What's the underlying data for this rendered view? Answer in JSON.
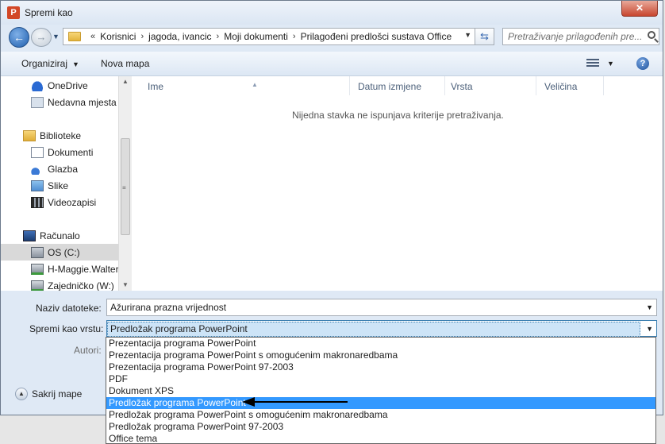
{
  "window": {
    "title": "Spremi kao",
    "close_label": "✕"
  },
  "address_bar": {
    "crumbs": [
      "Korisnici",
      "jagoda, ivancic",
      "Moji dokumenti",
      "Prilagođeni predlošci sustava Office"
    ],
    "overflow_label": "«",
    "separator": "›"
  },
  "search": {
    "placeholder": "Pretraživanje prilagođenih pre..."
  },
  "toolbar": {
    "organize_label": "Organiziraj",
    "new_folder_label": "Nova mapa"
  },
  "nav_pane": {
    "items": [
      {
        "label": "OneDrive",
        "icon": "onedrive-icon"
      },
      {
        "label": "Nedavna mjesta",
        "icon": "recent-places-icon"
      },
      {
        "label": "Biblioteke",
        "icon": "libraries-icon"
      },
      {
        "label": "Dokumenti",
        "icon": "documents-icon"
      },
      {
        "label": "Glazba",
        "icon": "music-icon"
      },
      {
        "label": "Slike",
        "icon": "pictures-icon"
      },
      {
        "label": "Videozapisi",
        "icon": "videos-icon"
      },
      {
        "label": "Računalo",
        "icon": "computer-icon"
      },
      {
        "label": "OS (C:)",
        "icon": "drive-icon"
      },
      {
        "label": "H-Maggie.Walter",
        "icon": "network-drive-icon"
      },
      {
        "label": "Zajedničko (W:)",
        "icon": "network-drive-icon"
      }
    ]
  },
  "file_list": {
    "columns": [
      "Ime",
      "Datum izmjene",
      "Vrsta",
      "Veličina"
    ],
    "empty_message": "Nijedna stavka ne ispunjava kriterije pretraživanja."
  },
  "form": {
    "filename_label": "Naziv datoteke:",
    "filename_value": "Ažurirana prazna vrijednost",
    "type_label": "Spremi kao vrstu:",
    "type_value": "Predložak programa PowerPoint",
    "authors_label": "Autori:",
    "hide_folders_label": "Sakrij mape"
  },
  "type_options": [
    "Prezentacija programa PowerPoint",
    "Prezentacija programa PowerPoint s omogućenim makronaredbama",
    "Prezentacija programa PowerPoint 97-2003",
    "PDF",
    "Dokument XPS",
    "Predložak programa PowerPoint",
    "Predložak programa PowerPoint s omogućenim makronaredbama",
    "Predložak programa PowerPoint 97-2003",
    "Office tema"
  ],
  "highlighted_option_index": 5,
  "colors": {
    "highlight": "#3399ff",
    "window_bg": "#dfe9f5",
    "annotation_arrow": "#000000"
  }
}
